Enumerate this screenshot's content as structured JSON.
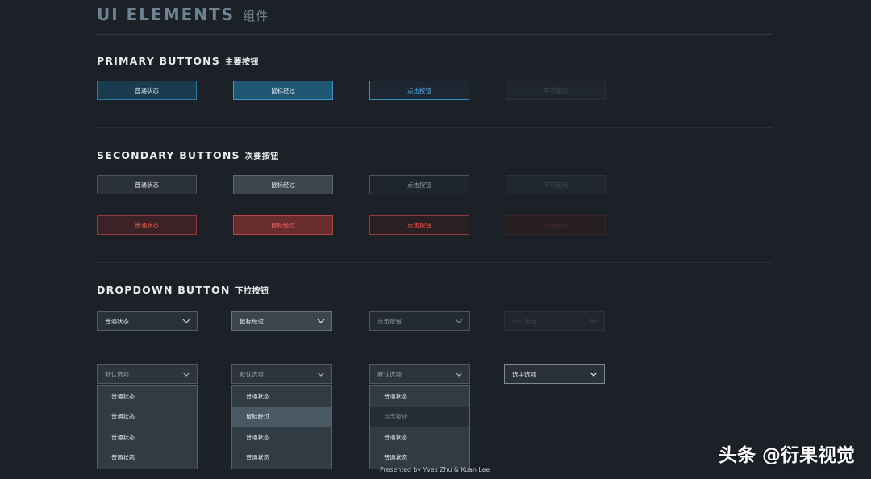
{
  "page": {
    "title": "UI ELEMENTS",
    "title_zh": "组件"
  },
  "primary": {
    "title": "PRIMARY BUTTONS",
    "title_zh": "主要按钮",
    "buttons": [
      "普通状态",
      "鼠标经过",
      "点击按钮",
      "不可使用"
    ]
  },
  "secondary": {
    "title": "SECONDARY BUTTONS",
    "title_zh": "次要按钮",
    "buttons": [
      "普通状态",
      "鼠标经过",
      "点击按钮",
      "不可使用"
    ],
    "danger_buttons": [
      "普通状态",
      "鼠标经过",
      "点击按钮",
      "不可使用"
    ]
  },
  "dropdown": {
    "title": "DROPDOWN BUTTON",
    "title_zh": "下拉按钮",
    "states": [
      "普通状态",
      "鼠标经过",
      "点击按钮",
      "不可使用"
    ],
    "open_defaults": [
      "默认选项",
      "默认选项",
      "默认选项"
    ],
    "selected_value": "选中选项",
    "menu1": [
      "普通状态",
      "普通状态",
      "普通状态",
      "普通状态"
    ],
    "menu2": [
      "普通状态",
      "鼠标经过",
      "普通状态",
      "普通状态"
    ],
    "menu3": [
      "普通状态",
      "点击按钮",
      "普通状态",
      "普通状态"
    ]
  },
  "colors": {
    "background": "#1c2128",
    "primary_accent": "#2e7ba8",
    "danger_accent": "#ee5a52"
  },
  "footer": "Presented by Yves Zhu & Kuan Lee",
  "watermark": "头条 @衍果视觉"
}
